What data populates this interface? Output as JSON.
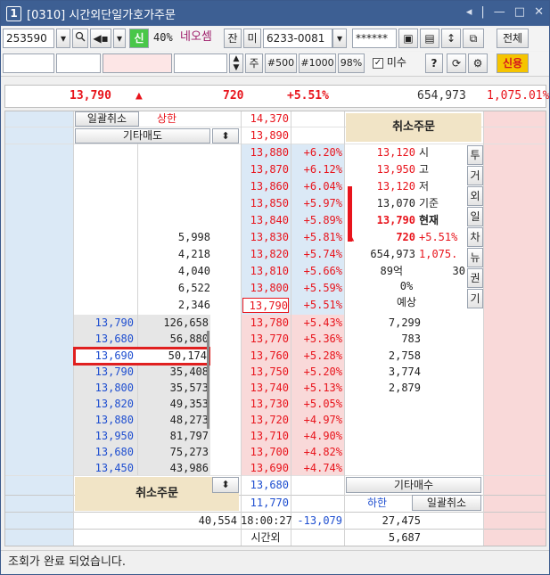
{
  "window": {
    "number": "1",
    "title": "[0310] 시간외단일가호가주문",
    "controls": [
      "◂",
      "|",
      "—",
      "□",
      "✕"
    ]
  },
  "toolbar": {
    "code": "253590",
    "percent": "40%",
    "stock_name": "네오셈",
    "tag_jan": "잔",
    "tag_mi": "미",
    "account": "6233-0081",
    "password": "******",
    "all_button": "전체",
    "sin_button": "신",
    "row2_ju": "주",
    "row2_500": "#500",
    "row2_1000": "#1000",
    "row2_98": "98%",
    "misu_label": "미수",
    "help": "?",
    "credit_button": "신용"
  },
  "summary": {
    "price": "13,790",
    "arrow": "▲",
    "change": "720",
    "rate": "+5.51%",
    "volume": "654,973",
    "turnover": "1,075.01%"
  },
  "top_area": {
    "bulk_cancel": "일괄취소",
    "upper_limit_label": "상한",
    "upper_limit_price": "14,370",
    "other_sell": "기타매도",
    "other_sell_price": "13,890",
    "cancel_order": "취소주문"
  },
  "ask_rows": [
    {
      "qty": "",
      "price": "13,880",
      "rate": "+6.20%"
    },
    {
      "qty": "",
      "price": "13,870",
      "rate": "+6.12%"
    },
    {
      "qty": "",
      "price": "13,860",
      "rate": "+6.04%"
    },
    {
      "qty": "",
      "price": "13,850",
      "rate": "+5.97%"
    },
    {
      "qty": "",
      "price": "13,840",
      "rate": "+5.89%"
    },
    {
      "qty": "5,998",
      "price": "13,830",
      "rate": "+5.81%"
    },
    {
      "qty": "4,218",
      "price": "13,820",
      "rate": "+5.74%"
    },
    {
      "qty": "4,040",
      "price": "13,810",
      "rate": "+5.66%"
    },
    {
      "qty": "6,522",
      "price": "13,800",
      "rate": "+5.59%"
    },
    {
      "qty": "2,346",
      "price": "13,790",
      "rate": "+5.51%"
    }
  ],
  "info_panel": [
    {
      "value": "13,120",
      "label": "시"
    },
    {
      "value": "13,950",
      "label": "고"
    },
    {
      "value": "13,120",
      "label": "저"
    },
    {
      "value": "13,070",
      "label": "기준"
    },
    {
      "value": "13,790",
      "label": "현재"
    }
  ],
  "info_change": {
    "arrow": "▲",
    "value": "720",
    "rate": "+5.51%"
  },
  "info_volume": {
    "value": "654,973",
    "turnover": "1,075."
  },
  "info_amount": {
    "value": "89억",
    "extra": "30"
  },
  "info_expect": {
    "rate": "0%",
    "label": "예상"
  },
  "side_tabs": [
    "투",
    "거",
    "외",
    "일",
    "차",
    "뉴",
    "권",
    "기"
  ],
  "bid_rows": [
    {
      "price": "13,780",
      "rate": "+5.43%",
      "remain": "7,299",
      "orders": [
        {
          "price": "13,790",
          "qty": "126,658"
        }
      ]
    },
    {
      "price": "13,770",
      "rate": "+5.36%",
      "remain": "783",
      "orders": [
        {
          "price": "13,680",
          "qty": "56,880"
        }
      ]
    },
    {
      "price": "13,760",
      "rate": "+5.28%",
      "remain": "2,758",
      "orders": [
        {
          "price": "13,690",
          "qty": "50,174"
        }
      ]
    },
    {
      "price": "13,750",
      "rate": "+5.20%",
      "remain": "3,774",
      "orders": [
        {
          "price": "13,790",
          "qty": "35,408"
        }
      ]
    },
    {
      "price": "13,740",
      "rate": "+5.13%",
      "remain": "2,879",
      "orders": [
        {
          "price": "13,800",
          "qty": "35,573"
        }
      ]
    },
    {
      "price": "13,730",
      "rate": "+5.05%",
      "remain": "",
      "orders": [
        {
          "price": "13,820",
          "qty": "49,353"
        }
      ]
    },
    {
      "price": "13,720",
      "rate": "+4.97%",
      "remain": "",
      "orders": [
        {
          "price": "13,880",
          "qty": "48,273"
        }
      ]
    },
    {
      "price": "13,710",
      "rate": "+4.90%",
      "remain": "",
      "orders": [
        {
          "price": "13,950",
          "qty": "81,797"
        }
      ]
    },
    {
      "price": "13,700",
      "rate": "+4.82%",
      "remain": "",
      "orders": [
        {
          "price": "13,680",
          "qty": "75,273"
        }
      ]
    },
    {
      "price": "13,690",
      "rate": "+4.74%",
      "remain": "",
      "orders": [
        {
          "price": "13,450",
          "qty": "43,986"
        }
      ]
    }
  ],
  "bottom": {
    "cancel_order": "취소주문",
    "bid_other_price": "13,680",
    "lower_limit_price": "11,770",
    "other_buy": "기타매수",
    "lower_limit_label": "하한",
    "bulk_cancel": "일괄취소",
    "total_sell": "40,554",
    "time": "18:00:27",
    "net": "-13,079",
    "total_buy": "27,475",
    "after_hours_label": "시간외",
    "after_hours_value": "5,687"
  },
  "status": "조회가 완료 되었습니다.",
  "colors": {
    "title_bg": "#3d5f93",
    "red": "#e8141c",
    "blue": "#1f4fd0",
    "ask_bg": "#dbe9f6",
    "bid_bg": "#f9d9d9",
    "highlight": "#e02020"
  }
}
